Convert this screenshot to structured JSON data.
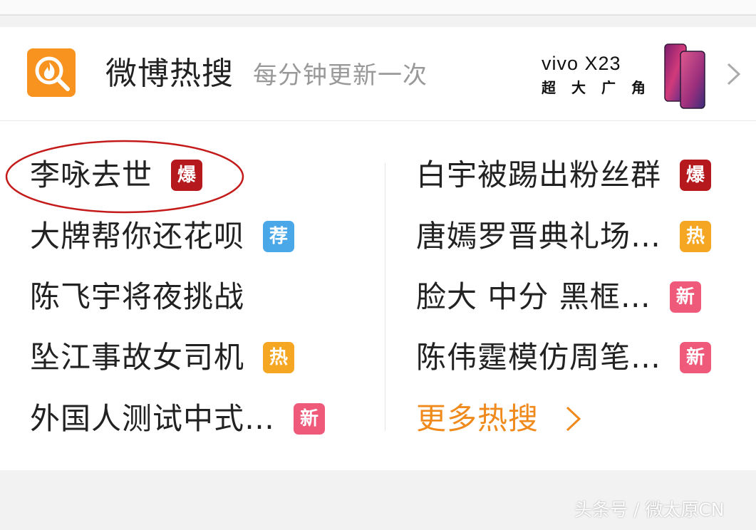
{
  "header": {
    "title": "微博热搜",
    "subtitle": "每分钟更新一次",
    "logo_icon": "weibo-hot-search-flame-icon",
    "more_icon": "chevron-right-icon"
  },
  "ad": {
    "brand": "vivo X23",
    "tagline": "超大广角",
    "image_icon": "phone-image-icon"
  },
  "colors": {
    "accent_orange": "#f7931e",
    "badge_bao": "#b5181d",
    "badge_jian": "#4aa7e8",
    "badge_re": "#f5a623",
    "badge_xin": "#ef5a7b",
    "more_text": "#f08a1c"
  },
  "hot_list": {
    "left": [
      {
        "text": "李咏去世",
        "badge": "爆",
        "badge_type": "bao",
        "highlighted": true
      },
      {
        "text": "大牌帮你还花呗",
        "badge": "荐",
        "badge_type": "jian"
      },
      {
        "text": "陈飞宇将夜挑战",
        "badge": "",
        "badge_type": "none"
      },
      {
        "text": "坠江事故女司机",
        "badge": "热",
        "badge_type": "re"
      },
      {
        "text": "外国人测试中式…",
        "badge": "新",
        "badge_type": "xin"
      }
    ],
    "right": [
      {
        "text": "白宇被踢出粉丝群",
        "badge": "爆",
        "badge_type": "bao"
      },
      {
        "text": "唐嫣罗晋典礼场…",
        "badge": "热",
        "badge_type": "re"
      },
      {
        "text": "脸大 中分 黑框…",
        "badge": "新",
        "badge_type": "xin"
      },
      {
        "text": "陈伟霆模仿周笔…",
        "badge": "新",
        "badge_type": "xin"
      }
    ],
    "more_label": "更多热搜"
  },
  "watermark": "头条号 / 微太原CN"
}
